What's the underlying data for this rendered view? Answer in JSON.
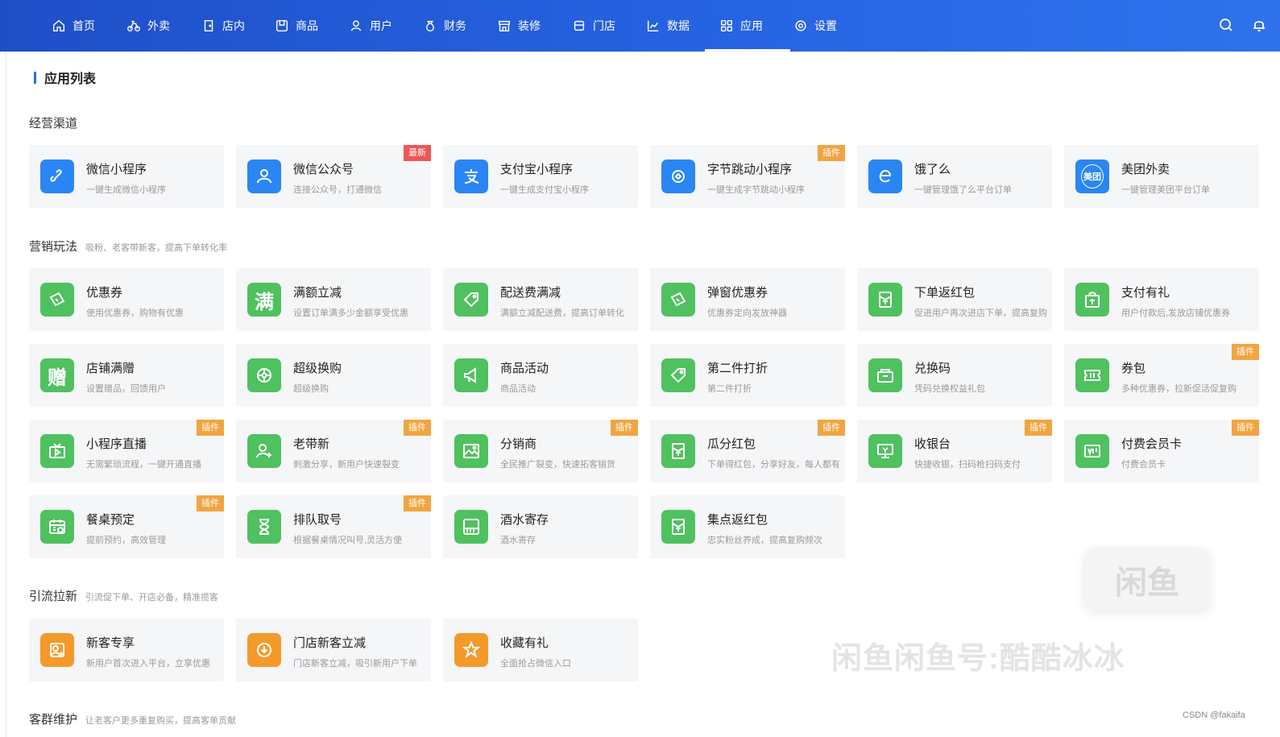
{
  "nav": {
    "items": [
      {
        "label": "首页",
        "icon": "home-icon"
      },
      {
        "label": "外卖",
        "icon": "bike-icon"
      },
      {
        "label": "店内",
        "icon": "door-icon"
      },
      {
        "label": "商品",
        "icon": "box-icon"
      },
      {
        "label": "用户",
        "icon": "user-icon"
      },
      {
        "label": "财务",
        "icon": "money-bag-icon"
      },
      {
        "label": "装修",
        "icon": "shop-icon"
      },
      {
        "label": "门店",
        "icon": "store-icon"
      },
      {
        "label": "数据",
        "icon": "chart-icon"
      },
      {
        "label": "应用",
        "icon": "grid-icon"
      },
      {
        "label": "设置",
        "icon": "gear-icon"
      }
    ],
    "active": "应用",
    "right_icons": [
      "search-icon",
      "bell-icon"
    ]
  },
  "page": {
    "title": "应用列表"
  },
  "sections": [
    {
      "title": "经营渠道",
      "subtitle": "",
      "cards": [
        {
          "name": "微信小程序",
          "desc": "一键生成微信小程序",
          "icon": "link-icon",
          "color": "blue",
          "badge": ""
        },
        {
          "name": "微信公众号",
          "desc": "连接公众号，打通微信",
          "icon": "person-icon",
          "color": "blue",
          "badge": "最新"
        },
        {
          "name": "支付宝小程序",
          "desc": "一键生成支付宝小程序",
          "icon": "alipay-icon",
          "color": "blue",
          "badge": ""
        },
        {
          "name": "字节跳动小程序",
          "desc": "一键生成字节跳动小程序",
          "icon": "bytedance-icon",
          "color": "blue",
          "badge": "插件"
        },
        {
          "name": "饿了么",
          "desc": "一键管理饿了么平台订单",
          "icon": "eleme-icon",
          "color": "blue",
          "badge": ""
        },
        {
          "name": "美团外卖",
          "desc": "一键管理美团平台订单",
          "icon": "meituan-icon",
          "color": "blue",
          "badge": "",
          "icon_text": "美团"
        }
      ]
    },
    {
      "title": "营销玩法",
      "subtitle": "吸粉、老客带新客，提高下单转化率",
      "cards": [
        {
          "name": "优惠券",
          "desc": "使用优惠券，购物有优惠",
          "icon": "coupon-icon",
          "color": "green",
          "badge": ""
        },
        {
          "name": "满额立减",
          "desc": "设置订单满多少金额享受优惠",
          "icon": "full-reduce-icon",
          "color": "green",
          "badge": "",
          "icon_text": "满"
        },
        {
          "name": "配送费满减",
          "desc": "满额立减配送费，提高订单转化",
          "icon": "tag-icon",
          "color": "green",
          "badge": ""
        },
        {
          "name": "弹窗优惠券",
          "desc": "优惠券定向发放神器",
          "icon": "popup-coupon-icon",
          "color": "green",
          "badge": ""
        },
        {
          "name": "下单返红包",
          "desc": "促进用户再次进店下单，提高复购",
          "icon": "red-envelope-icon",
          "color": "green",
          "badge": ""
        },
        {
          "name": "支付有礼",
          "desc": "用户付款后,发放店铺优惠券",
          "icon": "gift-bag-icon",
          "color": "green",
          "badge": ""
        },
        {
          "name": "店铺满赠",
          "desc": "设置赠品，回馈用户",
          "icon": "gift-icon",
          "color": "green",
          "badge": "",
          "icon_text": "赠"
        },
        {
          "name": "超级换购",
          "desc": "超级换购",
          "icon": "exchange-icon",
          "color": "green",
          "badge": ""
        },
        {
          "name": "商品活动",
          "desc": "商品活动",
          "icon": "megaphone-icon",
          "color": "green",
          "badge": ""
        },
        {
          "name": "第二件打折",
          "desc": "第二件打折",
          "icon": "discount-tag-icon",
          "color": "green",
          "badge": ""
        },
        {
          "name": "兑换码",
          "desc": "凭码兑换权益礼包",
          "icon": "redeem-code-icon",
          "color": "green",
          "badge": ""
        },
        {
          "name": "券包",
          "desc": "多种优惠券，拉新促活促复购",
          "icon": "ticket-icon",
          "color": "green",
          "badge": "插件"
        },
        {
          "name": "小程序直播",
          "desc": "无需繁琐流程，一键开通直播",
          "icon": "video-icon",
          "color": "green",
          "badge": "插件"
        },
        {
          "name": "老带新",
          "desc": "刺激分享，新用户快速裂变",
          "icon": "user-add-icon",
          "color": "green",
          "badge": "插件"
        },
        {
          "name": "分销商",
          "desc": "全民推广裂变，快速拓客销货",
          "icon": "image-icon",
          "color": "green",
          "badge": "插件"
        },
        {
          "name": "瓜分红包",
          "desc": "下单得红包，分享好友，每人都有",
          "icon": "split-envelope-icon",
          "color": "green",
          "badge": "插件"
        },
        {
          "name": "收银台",
          "desc": "快捷收银，扫码枪扫码支付",
          "icon": "cashier-icon",
          "color": "green",
          "badge": "插件"
        },
        {
          "name": "付费会员卡",
          "desc": "付费会员卡",
          "icon": "vip-card-icon",
          "color": "green",
          "badge": "插件"
        },
        {
          "name": "餐桌预定",
          "desc": "提前预约，高效管理",
          "icon": "calendar-icon",
          "color": "green",
          "badge": "插件"
        },
        {
          "name": "排队取号",
          "desc": "根据餐桌情况叫号,灵活方便",
          "icon": "hourglass-icon",
          "color": "green",
          "badge": "插件"
        },
        {
          "name": "酒水寄存",
          "desc": "酒水寄存",
          "icon": "storage-icon",
          "color": "green",
          "badge": ""
        },
        {
          "name": "集点返红包",
          "desc": "忠实粉丝养成，提高复购频次",
          "icon": "points-envelope-icon",
          "color": "green",
          "badge": ""
        }
      ]
    },
    {
      "title": "引流拉新",
      "subtitle": "引流促下单、开店必备，精准揽客",
      "cards": [
        {
          "name": "新客专享",
          "desc": "新用户首次进入平台，立享优惠",
          "icon": "new-user-icon",
          "color": "orange",
          "badge": ""
        },
        {
          "name": "门店新客立减",
          "desc": "门店新客立减，吸引新用户下单",
          "icon": "download-badge-icon",
          "color": "orange",
          "badge": ""
        },
        {
          "name": "收藏有礼",
          "desc": "全面抢占微信入口",
          "icon": "star-icon",
          "color": "orange",
          "badge": ""
        }
      ]
    },
    {
      "title": "客群维护",
      "subtitle": "让老客户更多重复购买，提高客单贡献",
      "cards": []
    }
  ],
  "watermark": {
    "box_text": "闲鱼",
    "text": "闲鱼闲鱼号:酷酷冰冰",
    "credit": "CSDN @fakaifa"
  }
}
